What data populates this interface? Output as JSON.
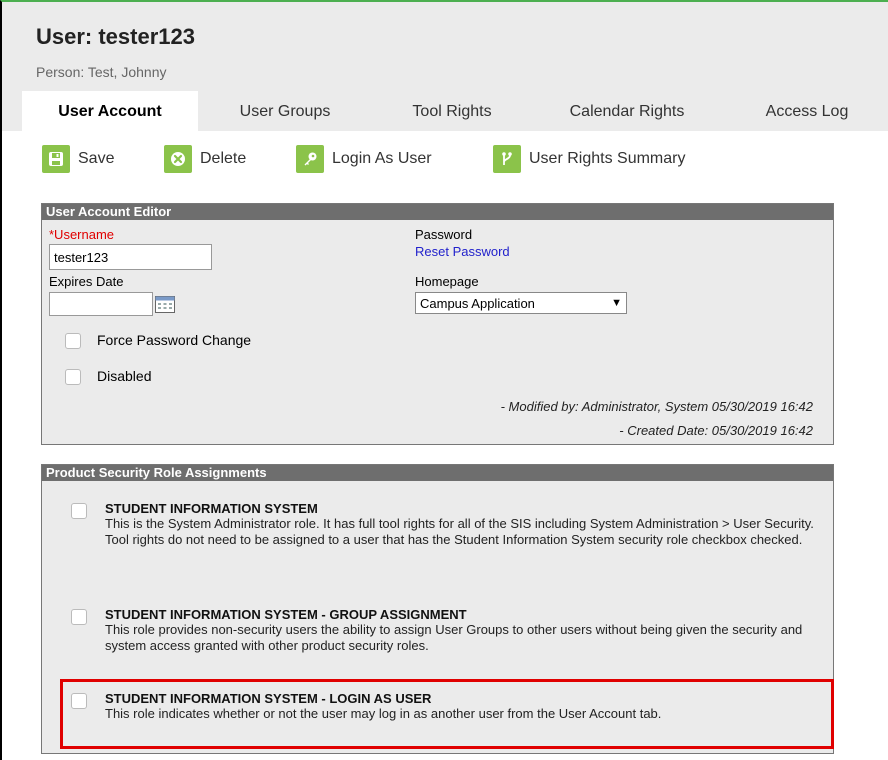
{
  "header": {
    "title": "User: tester123",
    "subtitle": "Person: Test, Johnny"
  },
  "tabs": [
    {
      "label": "User Account",
      "active": true
    },
    {
      "label": "User Groups",
      "active": false
    },
    {
      "label": "Tool Rights",
      "active": false
    },
    {
      "label": "Calendar Rights",
      "active": false
    },
    {
      "label": "Access Log",
      "active": false
    }
  ],
  "toolbar": {
    "save": "Save",
    "delete": "Delete",
    "login_as_user": "Login As User",
    "user_rights_summary": "User Rights Summary"
  },
  "editor": {
    "heading": "User Account Editor",
    "username_label": "*Username",
    "username_value": "tester123",
    "expires_label": "Expires Date",
    "expires_value": "",
    "password_label": "Password",
    "reset_password": "Reset Password",
    "homepage_label": "Homepage",
    "homepage_value": "Campus Application",
    "force_password_change": "Force Password Change",
    "disabled": "Disabled",
    "modified_by": "- Modified by: Administrator, System 05/30/2019 16:42",
    "created_date": "- Created Date: 05/30/2019 16:42"
  },
  "roles": {
    "heading": "Product Security Role Assignments",
    "items": [
      {
        "title": "STUDENT INFORMATION SYSTEM",
        "description": "This is the System Administrator role. It has full tool rights for all of the SIS including System Administration > User Security. Tool rights do not need to be assigned to a user that has the Student Information System security role checkbox checked.",
        "checked": false
      },
      {
        "title": "STUDENT INFORMATION SYSTEM - GROUP ASSIGNMENT",
        "description": "This role provides non-security users the ability to assign User Groups to other users without being given the security and system access granted with other product security roles.",
        "checked": false
      },
      {
        "title": "STUDENT INFORMATION SYSTEM - LOGIN AS USER",
        "description": "This role indicates whether or not the user may log in as another user from the User Account tab.",
        "checked": false
      }
    ]
  },
  "colors": {
    "toolbar_icon": "#8bc34a",
    "panel_header": "#6e6e6e",
    "required_label": "#e00000",
    "link": "#2222cc",
    "highlight": "#e00000"
  }
}
